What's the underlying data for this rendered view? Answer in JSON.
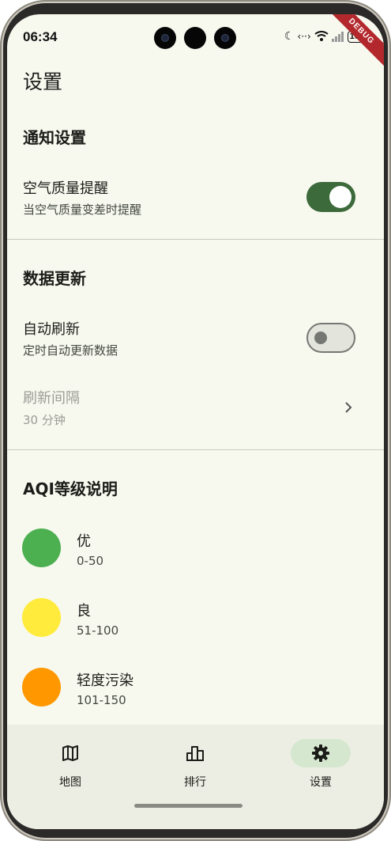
{
  "status_bar": {
    "time": "06:34",
    "battery": "100",
    "debug": "DEBUG"
  },
  "page": {
    "title": "设置"
  },
  "notifications": {
    "section_title": "通知设置",
    "air_alert": {
      "title": "空气质量提醒",
      "subtitle": "当空气质量变差时提醒",
      "enabled": true
    }
  },
  "data_update": {
    "section_title": "数据更新",
    "auto_refresh": {
      "title": "自动刷新",
      "subtitle": "定时自动更新数据",
      "enabled": false
    },
    "interval": {
      "title": "刷新间隔",
      "value": "30 分钟"
    }
  },
  "aqi": {
    "section_title": "AQI等级说明",
    "levels": [
      {
        "label": "优",
        "range": "0-50",
        "color": "#4caf50"
      },
      {
        "label": "良",
        "range": "51-100",
        "color": "#ffeb3b"
      },
      {
        "label": "轻度污染",
        "range": "101-150",
        "color": "#ff9800"
      }
    ]
  },
  "nav": {
    "items": [
      {
        "label": "地图",
        "icon": "map-icon",
        "active": false
      },
      {
        "label": "排行",
        "icon": "leaderboard-icon",
        "active": false
      },
      {
        "label": "设置",
        "icon": "gear-icon",
        "active": true
      }
    ]
  }
}
